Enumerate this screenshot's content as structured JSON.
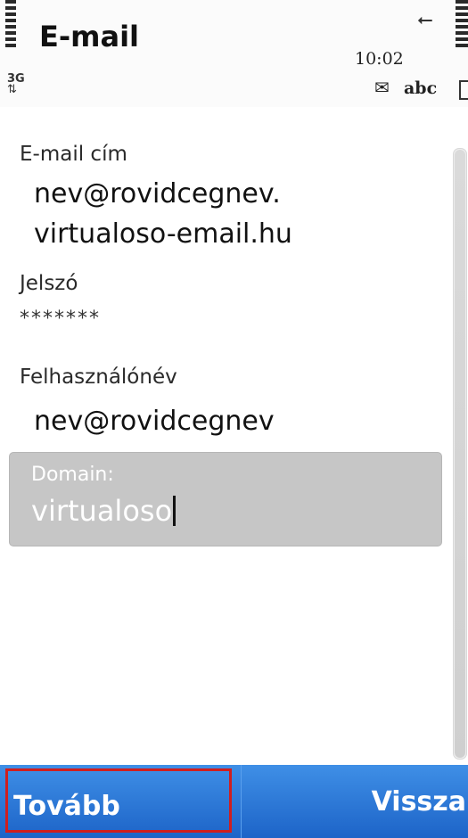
{
  "status_bar": {
    "network": "3G",
    "time": "10:02",
    "input_mode": "abc",
    "icons": [
      "signal-icon",
      "data-transfer-icon",
      "usb-icon",
      "message-icon",
      "battery-icon"
    ]
  },
  "app": {
    "title": "E-mail"
  },
  "form": {
    "email": {
      "label": "E-mail cím",
      "value_line1": "nev@rovidcegnev.",
      "value_line2": "virtualoso-email.hu"
    },
    "password": {
      "label": "Jelszó",
      "value": "*******"
    },
    "username": {
      "label": "Felhasználónév",
      "value": "nev@rovidcegnev"
    },
    "domain": {
      "label": "Domain:",
      "value": "virtualoso"
    }
  },
  "softkeys": {
    "left": "Tovább",
    "right": "Vissza"
  },
  "colors": {
    "softkey_bar": "#2a78d8",
    "highlight_border": "#d01e1e",
    "focused_field": "#c6c6c6"
  }
}
